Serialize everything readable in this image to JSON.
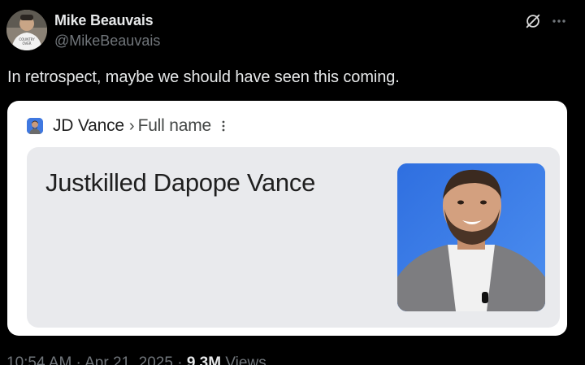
{
  "author": {
    "name": "Mike Beauvais",
    "handle": "@MikeBeauvais",
    "avatar_icon": "avatar-photo"
  },
  "actions": {
    "grok_icon": "grok-slash-icon",
    "more_icon": "more-horizontal-icon"
  },
  "tweet": {
    "text": "In retrospect, maybe we should have seen this coming."
  },
  "embedded_screenshot": {
    "favicon_icon": "person-thumbnail-icon",
    "entity": "JD Vance",
    "separator": "›",
    "attribute": "Full name",
    "menu_icon": "kebab-vertical-icon",
    "answer": "Justkilled Dapope Vance",
    "photo_icon": "portrait-photo"
  },
  "meta": {
    "time": "10:54 AM",
    "dot1": " · ",
    "date": "Apr 21, 2025",
    "dot2": " · ",
    "views_count": "9.3M",
    "views_label": " Views"
  },
  "colors": {
    "background": "#000000",
    "primary_text": "#e7e9ea",
    "secondary_text": "#71767b",
    "card_bg": "#ffffff",
    "answer_bg": "#e9eaed"
  }
}
